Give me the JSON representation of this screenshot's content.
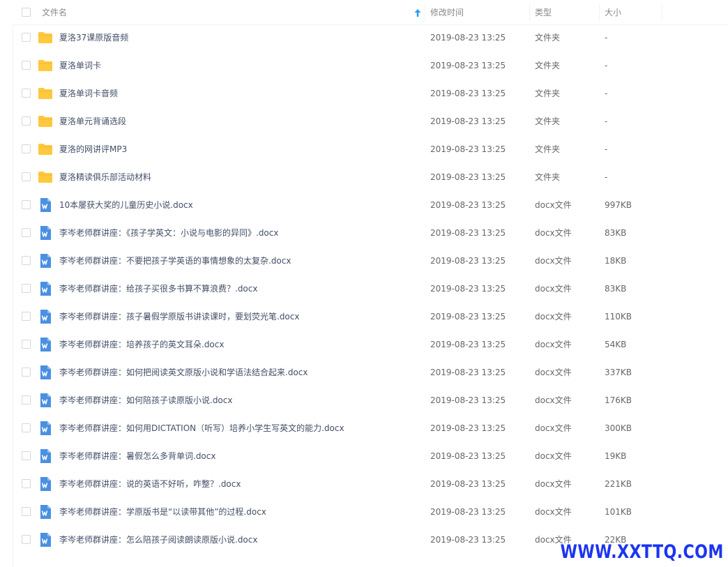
{
  "header": {
    "name_label": "文件名",
    "time_label": "修改时间",
    "type_label": "类型",
    "size_label": "大小",
    "sort_icon": "arrow-up-icon"
  },
  "files": [
    {
      "name": "夏洛37课原版音频",
      "time": "2019-08-23 13:25",
      "type": "文件夹",
      "size": "-",
      "icon": "folder-icon"
    },
    {
      "name": "夏洛单词卡",
      "time": "2019-08-23 13:25",
      "type": "文件夹",
      "size": "-",
      "icon": "folder-icon"
    },
    {
      "name": "夏洛单词卡音频",
      "time": "2019-08-23 13:25",
      "type": "文件夹",
      "size": "-",
      "icon": "folder-icon"
    },
    {
      "name": "夏洛单元背诵选段",
      "time": "2019-08-23 13:25",
      "type": "文件夹",
      "size": "-",
      "icon": "folder-icon"
    },
    {
      "name": "夏洛的网讲评MP3",
      "time": "2019-08-23 13:25",
      "type": "文件夹",
      "size": "-",
      "icon": "folder-icon"
    },
    {
      "name": "夏洛精读俱乐部活动材料",
      "time": "2019-08-23 13:25",
      "type": "文件夹",
      "size": "-",
      "icon": "folder-icon"
    },
    {
      "name": "10本屡获大奖的儿童历史小说.docx",
      "time": "2019-08-23 13:25",
      "type": "docx文件",
      "size": "997KB",
      "icon": "word-doc-icon"
    },
    {
      "name": "李岑老师群讲座：《孩子学英文：小说与电影的异同》.docx",
      "time": "2019-08-23 13:25",
      "type": "docx文件",
      "size": "83KB",
      "icon": "word-doc-icon"
    },
    {
      "name": "李岑老师群讲座：不要把孩子学英语的事情想象的太复杂.docx",
      "time": "2019-08-23 13:25",
      "type": "docx文件",
      "size": "18KB",
      "icon": "word-doc-icon"
    },
    {
      "name": "李岑老师群讲座：给孩子买很多书算不算浪费？.docx",
      "time": "2019-08-23 13:25",
      "type": "docx文件",
      "size": "83KB",
      "icon": "word-doc-icon"
    },
    {
      "name": "李岑老师群讲座：孩子暑假学原版书讲读课时，要划荧光笔.docx",
      "time": "2019-08-23 13:25",
      "type": "docx文件",
      "size": "110KB",
      "icon": "word-doc-icon"
    },
    {
      "name": "李岑老师群讲座：培养孩子的英文耳朵.docx",
      "time": "2019-08-23 13:25",
      "type": "docx文件",
      "size": "54KB",
      "icon": "word-doc-icon"
    },
    {
      "name": "李岑老师群讲座：如何把阅读英文原版小说和学语法结合起来.docx",
      "time": "2019-08-23 13:25",
      "type": "docx文件",
      "size": "337KB",
      "icon": "word-doc-icon"
    },
    {
      "name": "李岑老师群讲座：如何陪孩子读原版小说.docx",
      "time": "2019-08-23 13:25",
      "type": "docx文件",
      "size": "176KB",
      "icon": "word-doc-icon"
    },
    {
      "name": "李岑老师群讲座：如何用DICTATION（听写）培养小学生写英文的能力.docx",
      "time": "2019-08-23 13:25",
      "type": "docx文件",
      "size": "300KB",
      "icon": "word-doc-icon"
    },
    {
      "name": "李岑老师群讲座：暑假怎么多背单词.docx",
      "time": "2019-08-23 13:25",
      "type": "docx文件",
      "size": "19KB",
      "icon": "word-doc-icon"
    },
    {
      "name": "李岑老师群讲座：说的英语不好听，咋整？.docx",
      "time": "2019-08-23 13:25",
      "type": "docx文件",
      "size": "221KB",
      "icon": "word-doc-icon"
    },
    {
      "name": "李岑老师群讲座：学原版书是“以读带其他”的过程.docx",
      "time": "2019-08-23 13:25",
      "type": "docx文件",
      "size": "101KB",
      "icon": "word-doc-icon"
    },
    {
      "name": "李岑老师群讲座：怎么陪孩子阅读朗读原版小说.docx",
      "time": "2019-08-23 13:25",
      "type": "docx文件",
      "size": "22KB",
      "icon": "word-doc-icon"
    }
  ],
  "watermark": "WWW.XXTTQ.COM",
  "colors": {
    "folder": "#ffc83d",
    "word_icon": "#4a90e2",
    "sort_arrow": "#2c9cf2",
    "watermark": "#1c35f0"
  }
}
